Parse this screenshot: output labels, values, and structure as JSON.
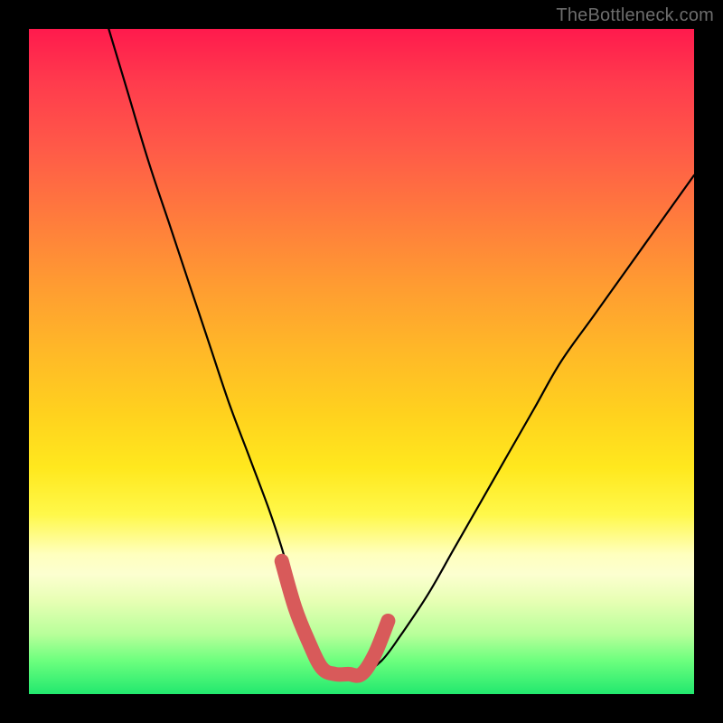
{
  "watermark": "TheBottleneck.com",
  "chart_data": {
    "type": "line",
    "title": "",
    "xlabel": "",
    "ylabel": "",
    "xlim": [
      0,
      100
    ],
    "ylim": [
      0,
      100
    ],
    "series": [
      {
        "name": "main-curve",
        "x": [
          12,
          15,
          18,
          21,
          24,
          27,
          30,
          33,
          36,
          38,
          40,
          42,
          44,
          46,
          48,
          50,
          53,
          56,
          60,
          64,
          68,
          72,
          76,
          80,
          85,
          90,
          95,
          100
        ],
        "values": [
          100,
          90,
          80,
          71,
          62,
          53,
          44,
          36,
          28,
          22,
          15,
          9,
          5,
          3,
          3,
          3,
          5,
          9,
          15,
          22,
          29,
          36,
          43,
          50,
          57,
          64,
          71,
          78
        ]
      },
      {
        "name": "highlight-segment",
        "x": [
          38,
          40,
          42,
          44,
          46,
          48,
          50,
          52,
          54
        ],
        "values": [
          20,
          13,
          8,
          4,
          3,
          3,
          3,
          6,
          11
        ]
      }
    ]
  }
}
